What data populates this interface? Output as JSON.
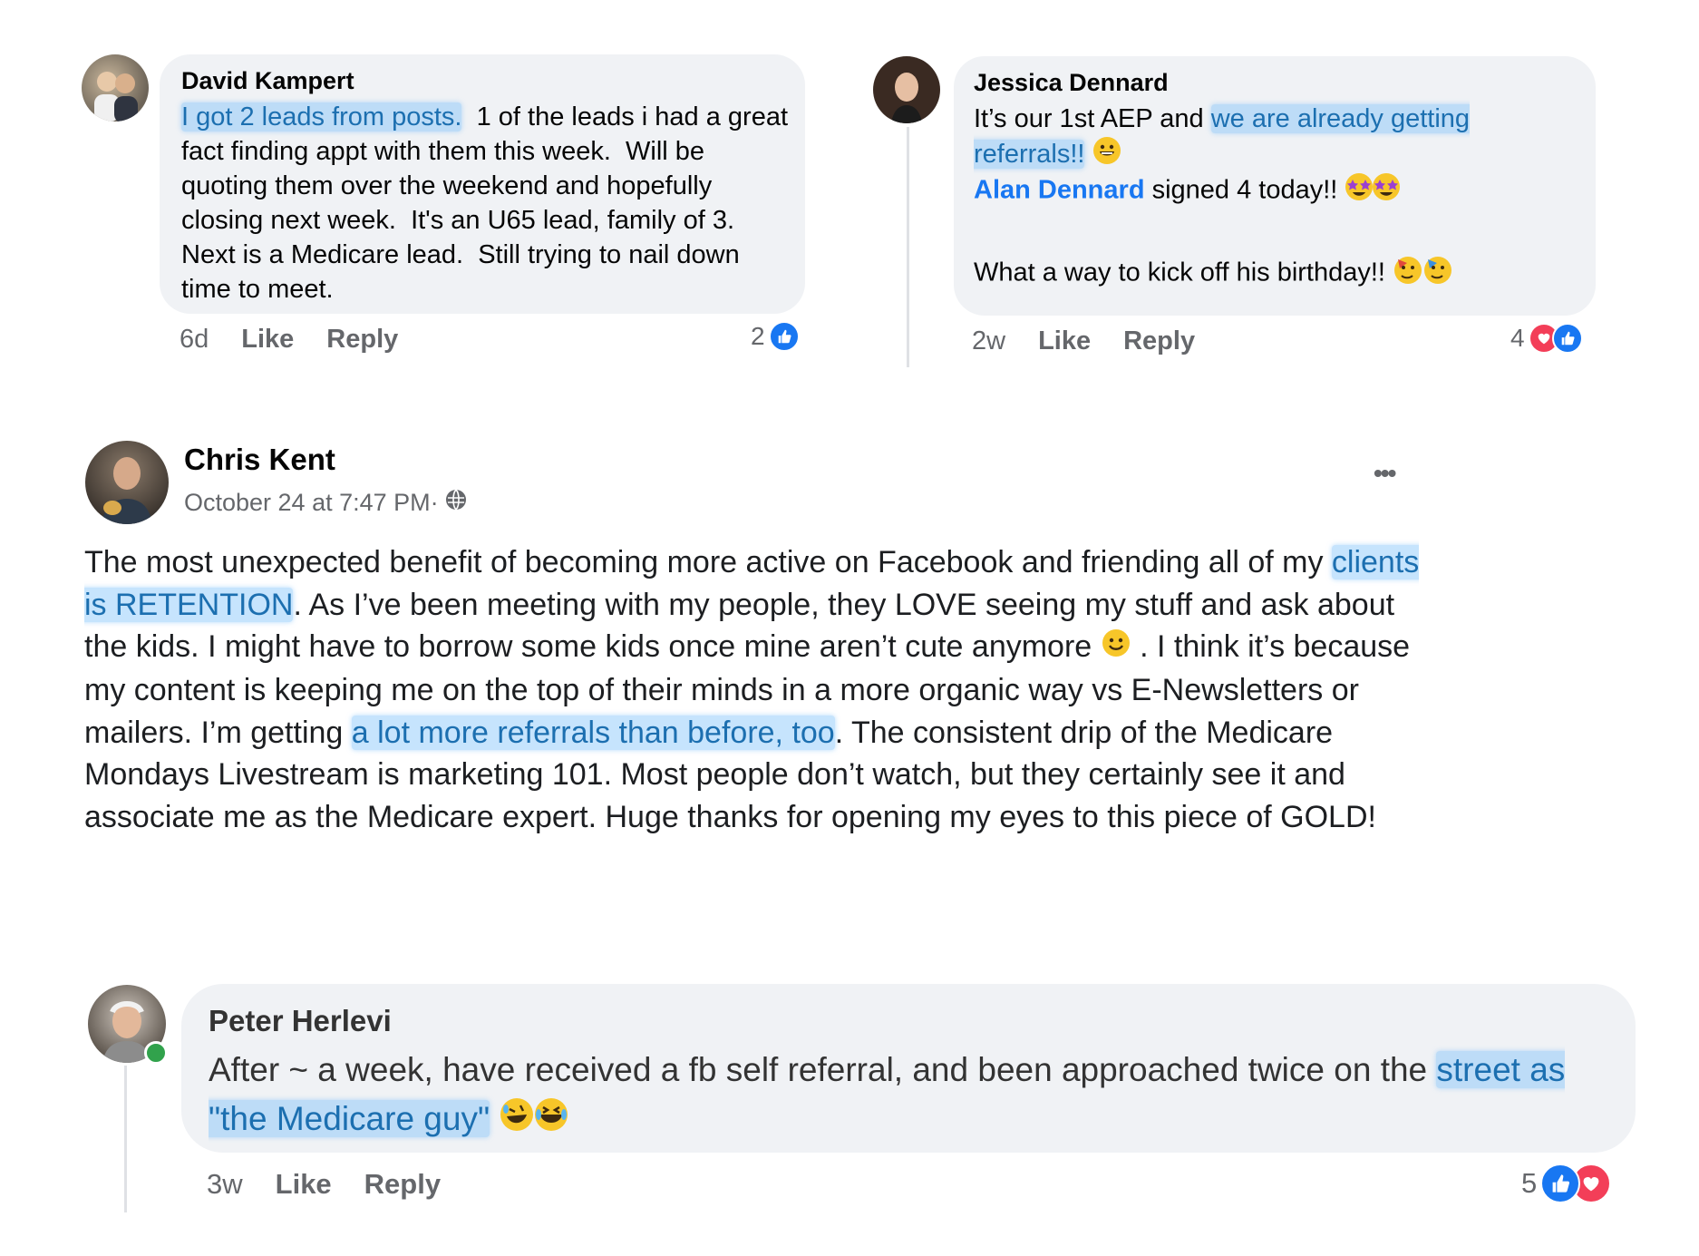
{
  "comment1": {
    "author": "David Kampert",
    "highlight": "I got 2 leads from posts.",
    "text_rest": "  1 of the leads i had a great fact finding appt with them this week.  Will be quoting them over the weekend and hopefully closing next week.  It's an U65 lead, family of 3.  Next is a Medicare lead.  Still trying to nail down time to meet.",
    "time": "6d",
    "like_label": "Like",
    "reply_label": "Reply",
    "reaction_count": "2"
  },
  "comment2": {
    "author": "Jessica Dennard",
    "text_before": "It’s our 1st AEP and ",
    "highlight": "we are already getting referrals!!",
    "mention": "Alan Dennard",
    "line2_rest": " signed 4 today!!",
    "line3": "What a way to kick off his birthday!!",
    "time": "2w",
    "like_label": "Like",
    "reply_label": "Reply",
    "reaction_count": "4"
  },
  "post": {
    "author": "Chris Kent",
    "timestamp": "October 24 at 7:47 PM·",
    "text_p1": "The most unexpected benefit of becoming more active on Facebook and friending all of my ",
    "highlight1": "clients is RETENTION",
    "text_p2": ". As I’ve been meeting with my people, they LOVE seeing my stuff and ask about the kids.  I might have to borrow some kids once mine aren’t cute anymore ",
    "text_p3": " .  I think it’s because my content is keeping me on the top of their minds in a more organic way vs E-Newsletters or mailers.  I’m getting ",
    "highlight2": "a lot more referrals than before, too",
    "text_p4": ". The consistent drip of the Medicare Mondays Livestream is marketing 101.  Most people don’t watch, but they certainly see it and associate me as the Medicare expert.  Huge thanks for opening my eyes to this piece of GOLD!",
    "more_label": "•••"
  },
  "comment3": {
    "author": "Peter Herlevi",
    "text_before": "After ~ a week, have received a fb self referral, and been approached twice on the ",
    "highlight": "street as \"the Medicare guy\"",
    "time": "3w",
    "like_label": "Like",
    "reply_label": "Reply",
    "reaction_count": "5"
  }
}
